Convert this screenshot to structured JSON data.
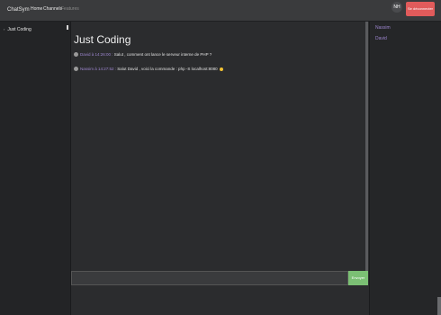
{
  "navbar": {
    "brand": "ChatSym",
    "links": [
      "Home",
      "Channels",
      "Features"
    ],
    "avatar_initials": "NH",
    "logout_label": "Se déconnecter"
  },
  "channels": [
    {
      "label": "Just Coding"
    }
  ],
  "main": {
    "title": "Just Coding",
    "messages": [
      {
        "author": "David à 14:26:00 :",
        "text": " Salut , comment ont lance le serveur interne de PHP ?"
      },
      {
        "author": "Nassim à 14:27:52 :",
        "text": " Salut David , voici la commande : php -S localhost:8080"
      }
    ],
    "input_placeholder": "",
    "send_label": "Envoyer"
  },
  "users": [
    "Nassim",
    "David"
  ],
  "colors": {
    "accent_purple": "#9d86cf",
    "send_green": "#7bbf74",
    "logout_red": "#e15b5b"
  }
}
